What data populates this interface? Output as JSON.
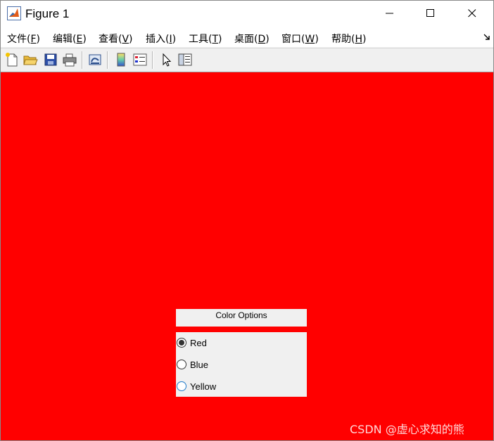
{
  "window": {
    "title": "Figure 1",
    "icon": "matlab-icon",
    "controls": [
      "minimize-icon",
      "maximize-icon",
      "close-icon"
    ]
  },
  "menu": {
    "items": [
      {
        "label": "文件(",
        "key": "F",
        "end": ")"
      },
      {
        "label": "编辑(",
        "key": "E",
        "end": ")"
      },
      {
        "label": "查看(",
        "key": "V",
        "end": ")"
      },
      {
        "label": "插入(",
        "key": "I",
        "end": ")"
      },
      {
        "label": "工具(",
        "key": "T",
        "end": ")"
      },
      {
        "label": "桌面(",
        "key": "D",
        "end": ")"
      },
      {
        "label": "窗口(",
        "key": "W",
        "end": ")"
      },
      {
        "label": "帮助(",
        "key": "H",
        "end": ")"
      }
    ]
  },
  "toolbar": {
    "buttons": [
      "new-figure-icon",
      "open-file-icon",
      "save-icon",
      "print-icon",
      "link-plot-icon",
      "insert-colorbar-icon",
      "insert-legend-icon",
      "edit-plot-pointer-icon",
      "property-inspector-icon"
    ]
  },
  "figure": {
    "background_color": "#ff0000"
  },
  "button_group": {
    "title": "Color Options",
    "options": [
      {
        "label": "Red",
        "selected": true
      },
      {
        "label": "Blue",
        "selected": false
      },
      {
        "label": "Yellow",
        "selected": false
      }
    ]
  },
  "watermark": "CSDN @虚心求知的熊"
}
